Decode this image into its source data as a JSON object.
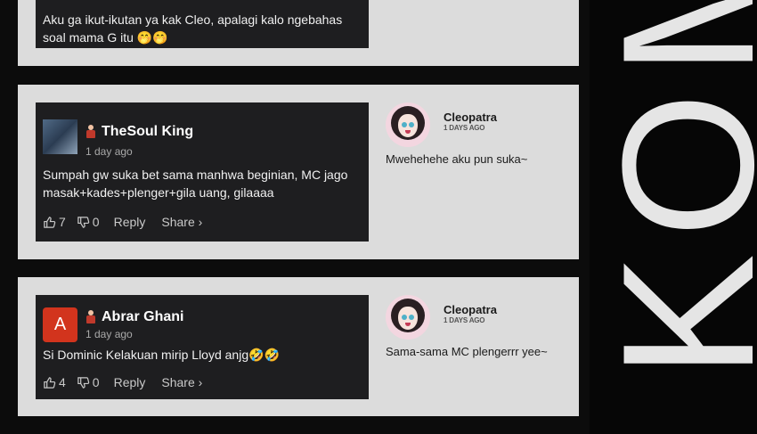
{
  "side_banner": {
    "text": "KOMENTAR"
  },
  "comments": [
    {
      "text": "Aku ga ikut-ikutan ya kak Cleo, apalagi kalo ngebahas soal mama G itu 🤭🤭"
    },
    {
      "username": "TheSoul King",
      "time": "1 day ago",
      "text": "Sumpah gw suka bet sama manhwa beginian, MC jago masak+kades+plenger+gila uang, gilaaaa",
      "likes": "7",
      "dislikes": "0",
      "reply_label": "Reply",
      "share_label": "Share ›",
      "reply": {
        "name": "Cleopatra",
        "time": "1 DAYS AGO",
        "text": "Mwehehehe aku pun suka~"
      }
    },
    {
      "username": "Abrar Ghani",
      "avatar_letter": "A",
      "time": "1 day ago",
      "text": "Si Dominic Kelakuan mirip Lloyd anjg🤣🤣",
      "likes": "4",
      "dislikes": "0",
      "reply_label": "Reply",
      "share_label": "Share ›",
      "reply": {
        "name": "Cleopatra",
        "time": "1 DAYS AGO",
        "text": "Sama-sama MC plengerrr yee~"
      }
    }
  ],
  "colors": {
    "page_bg": "#0c0c0c",
    "panel_bg": "#dcdcdc",
    "card_bg": "#1e1e20",
    "avatar_red": "#d2341d"
  }
}
